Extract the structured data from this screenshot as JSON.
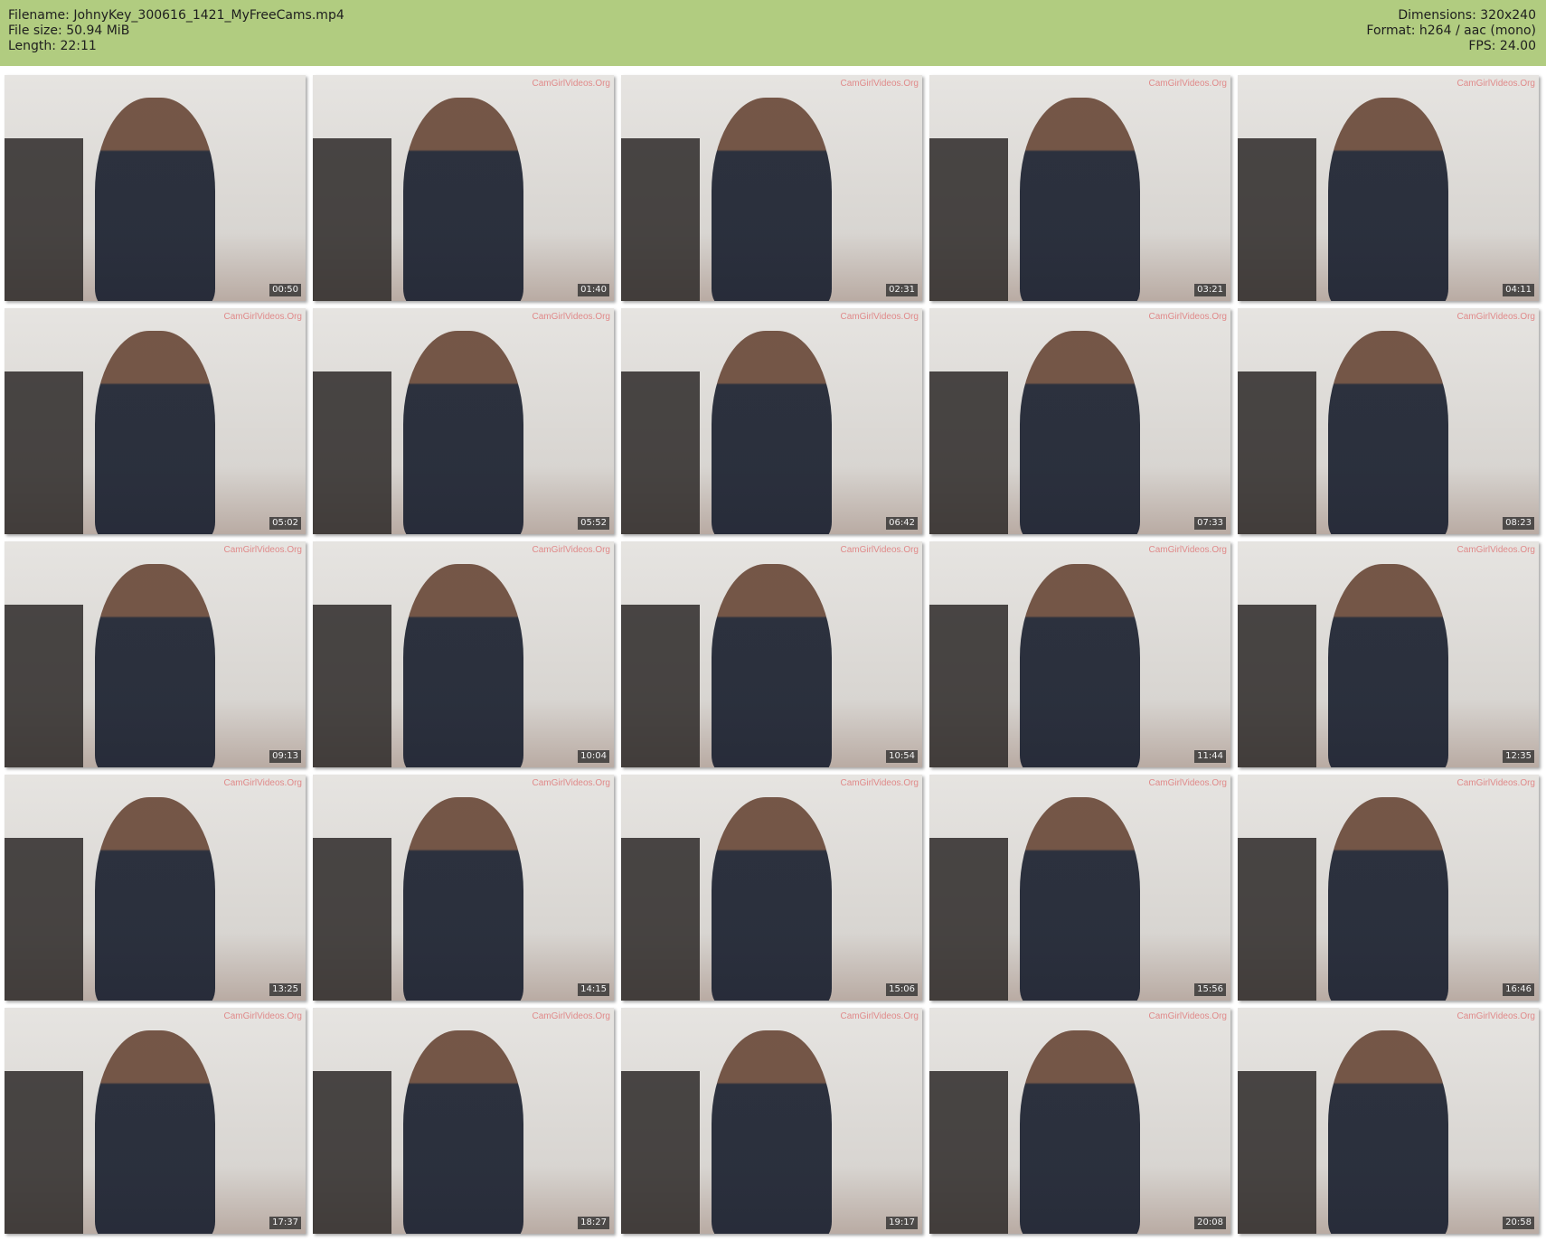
{
  "info": {
    "filename_label": "Filename:",
    "filename": "JohnyKey_300616_1421_MyFreeCams.mp4",
    "filesize_label": "File size:",
    "filesize": "50.94 MiB",
    "length_label": "Length:",
    "length": "22:11",
    "dimensions_label": "Dimensions:",
    "dimensions": "320x240",
    "format_label": "Format:",
    "format": "h264 / aac (mono)",
    "fps_label": "FPS:",
    "fps": "24.00"
  },
  "watermark": "CamGirlVideos.Org",
  "thumbnails": [
    {
      "time": "00:50"
    },
    {
      "time": "01:40"
    },
    {
      "time": "02:31"
    },
    {
      "time": "03:21"
    },
    {
      "time": "04:11"
    },
    {
      "time": "05:02"
    },
    {
      "time": "05:52"
    },
    {
      "time": "06:42"
    },
    {
      "time": "07:33"
    },
    {
      "time": "08:23"
    },
    {
      "time": "09:13"
    },
    {
      "time": "10:04"
    },
    {
      "time": "10:54"
    },
    {
      "time": "11:44"
    },
    {
      "time": "12:35"
    },
    {
      "time": "13:25"
    },
    {
      "time": "14:15"
    },
    {
      "time": "15:06"
    },
    {
      "time": "15:56"
    },
    {
      "time": "16:46"
    },
    {
      "time": "17:37"
    },
    {
      "time": "18:27"
    },
    {
      "time": "19:17"
    },
    {
      "time": "20:08"
    },
    {
      "time": "20:58"
    }
  ]
}
